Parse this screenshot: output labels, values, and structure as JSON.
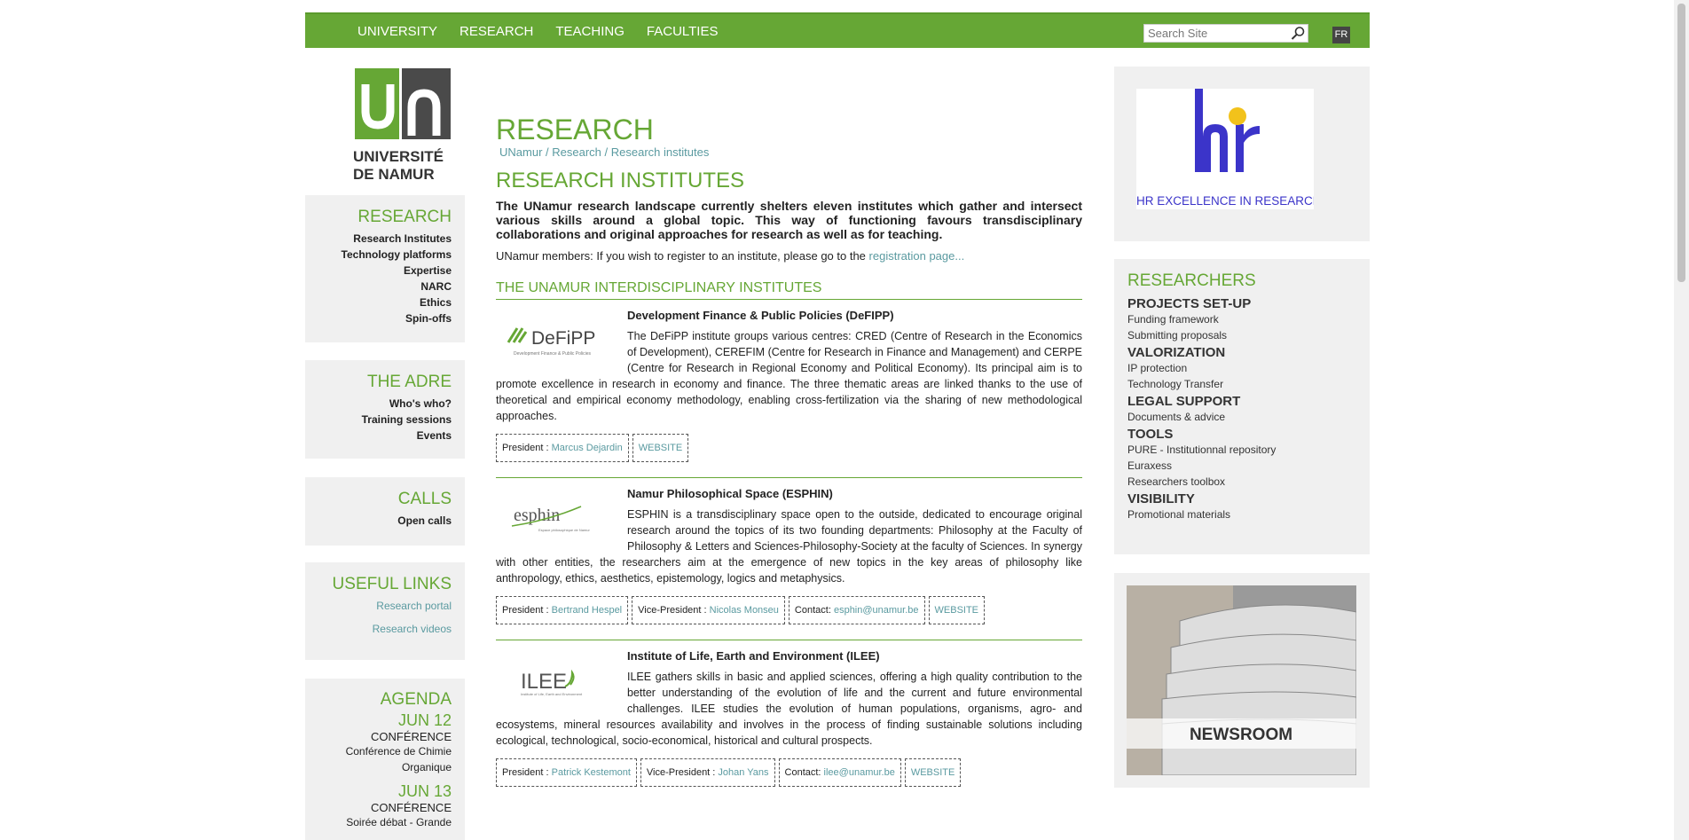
{
  "topnav": {
    "items": [
      "UNIVERSITY",
      "RESEARCH",
      "TEACHING",
      "FACULTIES"
    ],
    "search_placeholder": "Search Site",
    "lang": "FR"
  },
  "logo": {
    "line1": "UNIVERSITÉ",
    "line2": "DE NAMUR"
  },
  "sidebar": {
    "research": {
      "title": "RESEARCH",
      "items": [
        "Research Institutes",
        "Technology platforms",
        "Expertise",
        "NARC",
        "Ethics",
        "Spin-offs"
      ]
    },
    "adre": {
      "title": "THE ADRE",
      "items": [
        "Who's who?",
        "Training sessions",
        "Events"
      ]
    },
    "calls": {
      "title": "CALLS",
      "items": [
        "Open calls"
      ]
    },
    "useful": {
      "title": "USEFUL LINKS",
      "items": [
        "Research portal",
        "Research videos"
      ]
    },
    "agenda": {
      "title": "AGENDA",
      "events": [
        {
          "date": "JUN 12",
          "type": "CONFÉRENCE",
          "title": "Conférence de Chimie Organique"
        },
        {
          "date": "JUN 13",
          "type": "CONFÉRENCE",
          "title": "Soirée débat - Grande"
        }
      ]
    }
  },
  "main": {
    "title": "RESEARCH",
    "breadcrumb": [
      "UNamur",
      "Research",
      "Research institutes"
    ],
    "subtitle": "RESEARCH INSTITUTES",
    "intro": "The UNamur research landscape currently shelters eleven institutes which gather and intersect various skills around a global topic. This way of functioning favours transdisciplinary collaborations and original approaches for research as well as for teaching.",
    "members_text": "UNamur members: If you wish to register to an institute, please go to the ",
    "members_link": "registration page...",
    "section_title": "THE UNAMUR INTERDISCIPLINARY INSTITUTES",
    "institutes": [
      {
        "logo_text": "DeFiPP",
        "logo_sub": "Development Finance & Public Policies",
        "name": "Development Finance & Public Policies (DeFIPP)",
        "desc": "The DeFiPP institute groups various centres: CRED (Centre of Research in the Economics of Development), CEREFIM (Centre for Research in Finance and Management) and CERPE (Centre for Research in Regional Economy and Political Economy).  Its principal aim is to promote excellence in research in economy and finance.  The three thematic areas are linked thanks to the use of theoretical and empirical economy methodology, enabling cross-fertilization via the sharing of new methodological approaches.",
        "president_label": "President : ",
        "president": "Marcus Dejardin",
        "website": "WEBSITE"
      },
      {
        "logo_text": "esphin",
        "logo_sub": "Espace philosophique de Namur",
        "name": "Namur Philosophical Space (ESPHIN)",
        "desc": "ESPHIN is a transdisciplinary space open to the outside, dedicated to encourage original research around the topics of its two founding departments: Philosophy at the Faculty of Philosophy & Letters and Sciences-Philosophy-Society at the faculty of Sciences.  In synergy with other entities, the researchers aim at the emergence of new topics in the key areas of philosophy like anthropology, ethics, aesthetics, epistemology, logics and metaphysics.",
        "president_label": "President : ",
        "president": "Bertrand Hespel",
        "vp_label": "Vice-President : ",
        "vp": "Nicolas Monseu",
        "contact_label": "Contact: ",
        "contact": "esphin@unamur.be",
        "website": "WEBSITE"
      },
      {
        "logo_text": "ILEE",
        "logo_sub": "Institute of Life, Earth and Environment",
        "name": "Institute of Life, Earth and Environment (ILEE)",
        "desc": "ILEE gathers skills in basic and applied sciences, offering a high quality contribution to the better understanding of the evolution of life and the current and future environmental challenges.  ILEE studies the evolution of human populations, organisms, agro- and ecosystems, mineral resources availability and involves in the process of finding sustainable solutions including ecological, technological, socio-economical, historical and cultural prospects.",
        "president_label": "President : ",
        "president": "Patrick Kestemont",
        "vp_label": "Vice-President : ",
        "vp": "Johan Yans",
        "contact_label": "Contact: ",
        "contact": "ilee@unamur.be",
        "website": "WEBSITE"
      }
    ]
  },
  "right": {
    "hr_text": "HR EXCELLENCE IN RESEARCH",
    "researchers": {
      "title": "RESEARCHERS",
      "groups": [
        {
          "title": "PROJECTS SET-UP",
          "links": [
            "Funding framework",
            "Submitting proposals"
          ]
        },
        {
          "title": "VALORIZATION",
          "links": [
            "IP protection",
            "Technology Transfer"
          ]
        },
        {
          "title": "LEGAL SUPPORT",
          "links": [
            "Documents & advice"
          ]
        },
        {
          "title": "TOOLS",
          "links": [
            "PURE - Institutionnal repository",
            "Euraxess",
            "Researchers toolbox"
          ]
        },
        {
          "title": "VISIBILITY",
          "links": [
            "Promotional materials"
          ]
        }
      ]
    },
    "newsroom": "NEWSROOM"
  },
  "colors": {
    "brand_green": "#66a735",
    "link_teal": "#5a9aa0",
    "panel_grey": "#f0f0f0"
  }
}
